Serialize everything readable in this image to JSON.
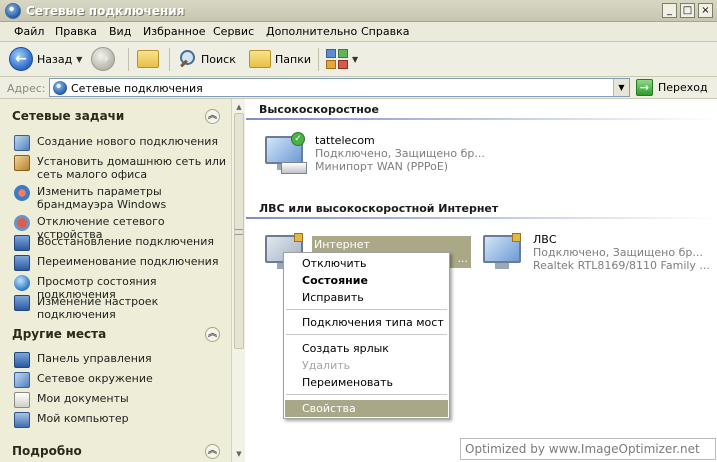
{
  "window": {
    "title": "Сетевые подключения",
    "buttons": {
      "minimize": "_",
      "maximize": "□",
      "close": "×"
    }
  },
  "menu": [
    "Файл",
    "Правка",
    "Вид",
    "Избранное",
    "Сервис",
    "Дополнительно",
    "Справка"
  ],
  "toolbar": {
    "back_label": "Назад",
    "search_label": "Поиск",
    "folders_label": "Папки"
  },
  "address": {
    "label": "Адрес:",
    "value": "Сетевые подключения",
    "go_label": "Переход"
  },
  "sidebar": {
    "tasks_title": "Сетевые задачи",
    "tasks": [
      {
        "label": "Создание нового подключения",
        "icon": "new-connection-icon"
      },
      {
        "label": "Установить домашнюю сеть или сеть малого офиса",
        "icon": "home-network-icon"
      },
      {
        "label": "Изменить параметры брандмауэра Windows",
        "icon": "firewall-icon"
      },
      {
        "label": "Отключение сетевого устройства",
        "icon": "disable-device-icon"
      },
      {
        "label": "Восстановление подключения",
        "icon": "repair-icon"
      },
      {
        "label": "Переименование подключения",
        "icon": "rename-icon"
      },
      {
        "label": "Просмотр состояния подключения",
        "icon": "status-icon"
      },
      {
        "label": "Изменение настроек подключения",
        "icon": "settings-icon"
      }
    ],
    "other_title": "Другие места",
    "other": [
      {
        "label": "Панель управления",
        "icon": "control-panel-icon"
      },
      {
        "label": "Сетевое окружение",
        "icon": "network-places-icon"
      },
      {
        "label": "Мои документы",
        "icon": "my-documents-icon"
      },
      {
        "label": "Мой компьютер",
        "icon": "my-computer-icon"
      }
    ],
    "details_title": "Подробно"
  },
  "main": {
    "group1_title": "Высокоскоростное",
    "conn1": {
      "name": "tattelecom",
      "status": "Подключено, Защищено бр...",
      "device": "Минипорт WAN (PPPoE)"
    },
    "group2_title": "ЛВС или высокоскоростной Интернет",
    "conn2": {
      "name": "Интернет",
      "dots": "..."
    },
    "conn3": {
      "name": "ЛВС",
      "status": "Подключено, Защищено бр...",
      "device": "Realtek RTL8169/8110 Family ..."
    }
  },
  "context_menu": {
    "disconnect": "Отключить",
    "status": "Состояние",
    "repair": "Исправить",
    "bridge": "Подключения типа мост",
    "shortcut": "Создать ярлык",
    "delete": "Удалить",
    "rename": "Переименовать",
    "properties": "Свойства"
  },
  "watermark": "Optimized by www.ImageOptimizer.net"
}
